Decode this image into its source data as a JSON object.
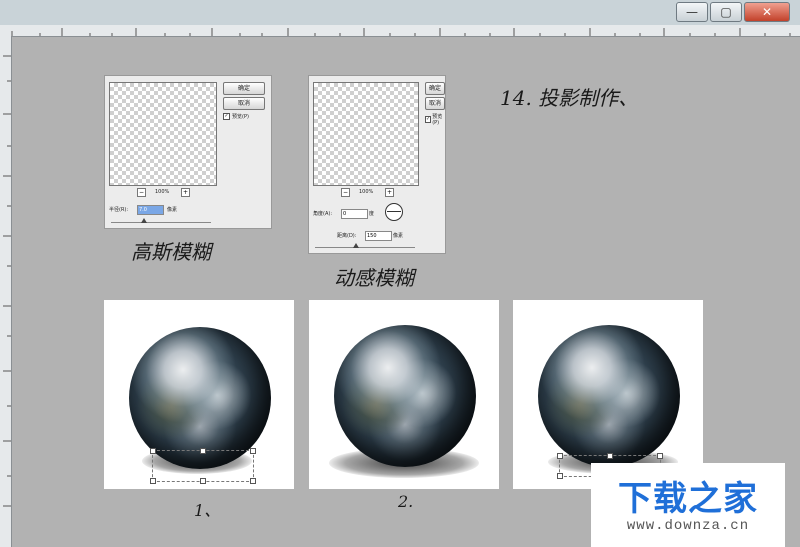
{
  "window": {
    "minimize_label": "—",
    "maximize_label": "▢",
    "close_label": "✕"
  },
  "gaussian_dialog": {
    "ok_label": "确定",
    "cancel_label": "取消",
    "preview_checkbox_label": "预览(P)",
    "zoom_out": "−",
    "zoom_in": "+",
    "zoom_level": "100%",
    "radius_label": "半径(R):",
    "radius_value": "7.0",
    "radius_unit": "像素"
  },
  "motion_dialog": {
    "ok_label": "确定",
    "cancel_label": "取消",
    "preview_checkbox_label": "预览(P)",
    "zoom_out": "−",
    "zoom_in": "+",
    "zoom_level": "100%",
    "angle_label": "角度(A):",
    "angle_value": "0",
    "angle_unit": "度",
    "distance_label": "距离(D):",
    "distance_value": "150",
    "distance_unit": "像素"
  },
  "handwriting": {
    "step_note": "14. 投影制作、",
    "gaussian_caption": "高斯模糊",
    "motion_caption": "动感模糊",
    "label_1": "1、",
    "label_2": "2."
  },
  "watermark": {
    "brand": "下载之家",
    "url": "www.downza.cn"
  },
  "colors": {
    "canvas": "#b2b2b2",
    "watermark_blue": "#1f6fd8"
  }
}
